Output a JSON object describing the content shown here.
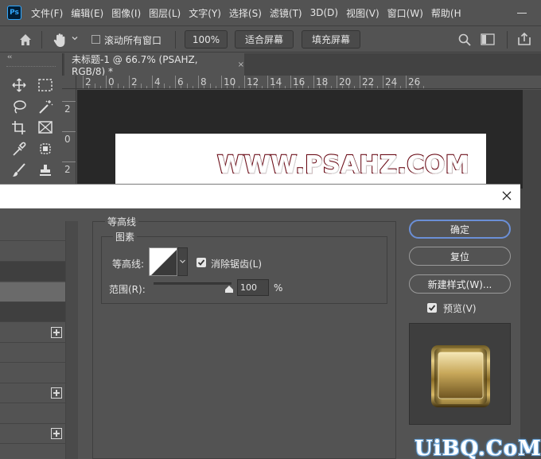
{
  "menubar": {
    "logo_text": "Ps",
    "items": [
      "文件(F)",
      "编辑(E)",
      "图像(I)",
      "图层(L)",
      "文字(Y)",
      "选择(S)",
      "滤镜(T)",
      "3D(D)",
      "视图(V)",
      "窗口(W)",
      "帮助(H"
    ]
  },
  "options_bar": {
    "scroll_all_windows_label": "滚动所有窗口",
    "zoom_value": "100%",
    "fit_screen_label": "适合屏幕",
    "fill_screen_label": "填充屏幕"
  },
  "tools": {
    "collapse_glyph": "‹‹",
    "items": [
      "move-tool",
      "marquee-tool",
      "lasso-tool",
      "magic-wand-tool",
      "crop-tool",
      "frame-tool",
      "eyedropper-tool",
      "patch-tool",
      "brush-tool",
      "stamp-tool"
    ]
  },
  "document": {
    "tab_title": "未标题-1 @ 66.7% (PSAHZ, RGB/8) *",
    "tab_close": "×",
    "canvas_text": "WWW.PSAHZ.COM"
  },
  "rulers": {
    "horizontal": [
      "2",
      "0",
      "2",
      "4",
      "6",
      "8",
      "10",
      "12",
      "14",
      "16",
      "18",
      "20",
      "22",
      "24",
      "26"
    ],
    "vertical": [
      "2",
      "0",
      "2"
    ]
  },
  "dialog": {
    "close_glyph": "✕",
    "group_outer_title": "等高线",
    "group_inner_title": "图素",
    "contour_label": "等高线:",
    "antialias_label": "消除锯齿(L)",
    "antialias_checked": true,
    "range_label": "范围(R):",
    "range_value": "100",
    "range_unit": "%",
    "range_fraction": 1.0,
    "buttons": {
      "ok": "确定",
      "reset": "复位",
      "new_style": "新建样式(W)..."
    },
    "preview_label": "预览(V)",
    "preview_checked": true,
    "style_rows": [
      "plain",
      "plain",
      "dark",
      "selected",
      "dark",
      "plus",
      "plain",
      "plain",
      "plus",
      "plain",
      "plus",
      "plain"
    ]
  },
  "watermark": "UiBQ.CoM",
  "colors": {
    "ui_bg": "#535353",
    "primary_button_border": "#6b8fd6",
    "text_stroke": "#6b0d18",
    "gold": "#b8973f"
  }
}
